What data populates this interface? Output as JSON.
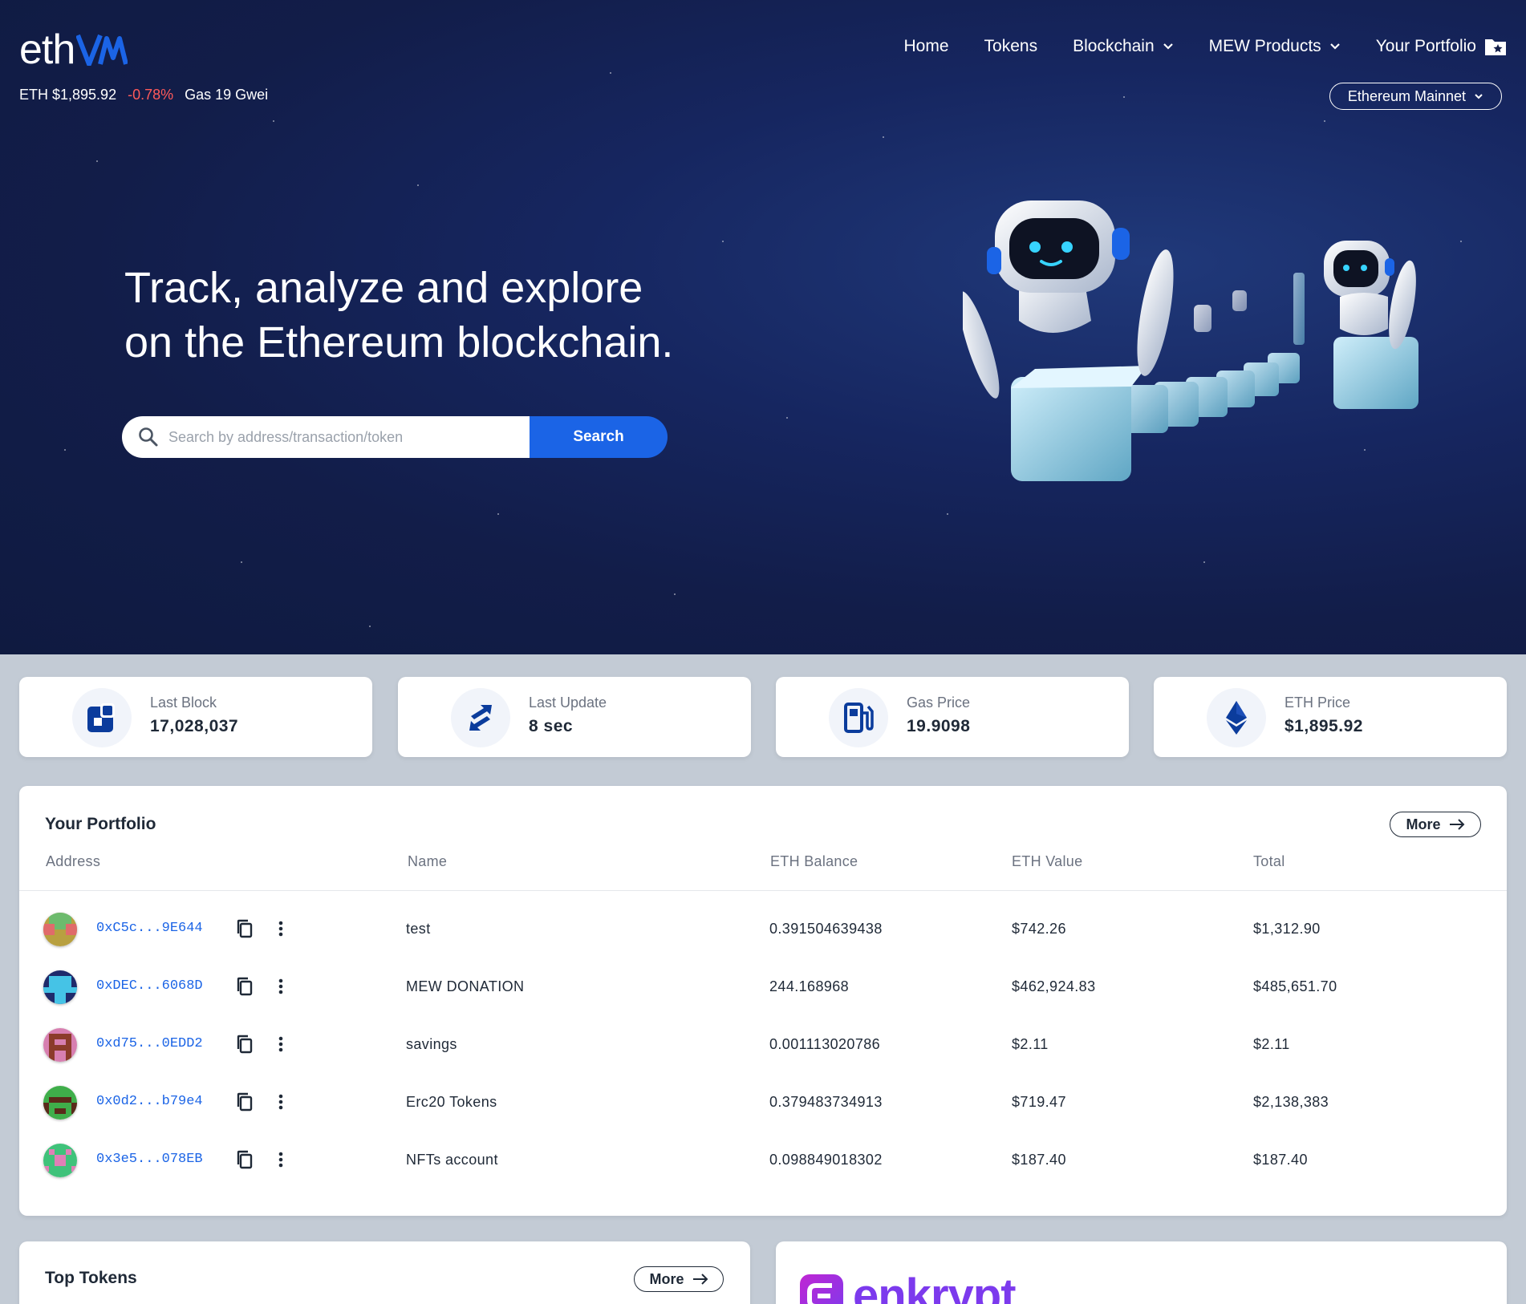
{
  "header": {
    "logo_text": "eth",
    "ticker": {
      "eth_price": "ETH $1,895.92",
      "change": "-0.78%",
      "gas": "Gas 19 Gwei"
    },
    "nav": [
      "Home",
      "Tokens",
      "Blockchain",
      "MEW Products",
      "Your Portfolio"
    ],
    "network": "Ethereum Mainnet"
  },
  "hero": {
    "title_line1": "Track, analyze and explore",
    "title_line2": "on the Ethereum blockchain.",
    "search_placeholder": "Search by address/transaction/token",
    "search_button": "Search"
  },
  "stats": [
    {
      "label": "Last Block",
      "value": "17,028,037",
      "icon": "block-icon"
    },
    {
      "label": "Last Update",
      "value": "8 sec",
      "icon": "sync-arrows-icon"
    },
    {
      "label": "Gas Price",
      "value": "19.9098",
      "icon": "gas-pump-icon"
    },
    {
      "label": "ETH Price",
      "value": "$1,895.92",
      "icon": "ethereum-icon"
    }
  ],
  "portfolio": {
    "title": "Your Portfolio",
    "more": "More",
    "columns": [
      "Address",
      "Name",
      "ETH Balance",
      "ETH Value",
      "Total"
    ],
    "rows": [
      {
        "address": "0xC5c...9E644",
        "name": "test",
        "balance": "0.391504639438",
        "value": "$742.26",
        "total": "$1,312.90"
      },
      {
        "address": "0xDEC...6068D",
        "name": "MEW DONATION",
        "balance": "244.168968",
        "value": "$462,924.83",
        "total": "$485,651.70"
      },
      {
        "address": "0xd75...0EDD2",
        "name": "savings",
        "balance": "0.001113020786",
        "value": "$2.11",
        "total": "$2.11"
      },
      {
        "address": "0x0d2...b79e4",
        "name": "Erc20 Tokens",
        "balance": "0.379483734913",
        "value": "$719.47",
        "total": "$2,138,383"
      },
      {
        "address": "0x3e5...078EB",
        "name": "NFTs account",
        "balance": "0.098849018302",
        "value": "$187.40",
        "total": "$187.40"
      }
    ]
  },
  "top_tokens": {
    "title": "Top Tokens",
    "more": "More"
  },
  "promo": {
    "brand": "enkrypt"
  },
  "colors": {
    "accent": "#1b64e6",
    "negative": "#ff5a5a",
    "hero_bg": "#121d49",
    "page_bg": "#c3cbd5"
  }
}
